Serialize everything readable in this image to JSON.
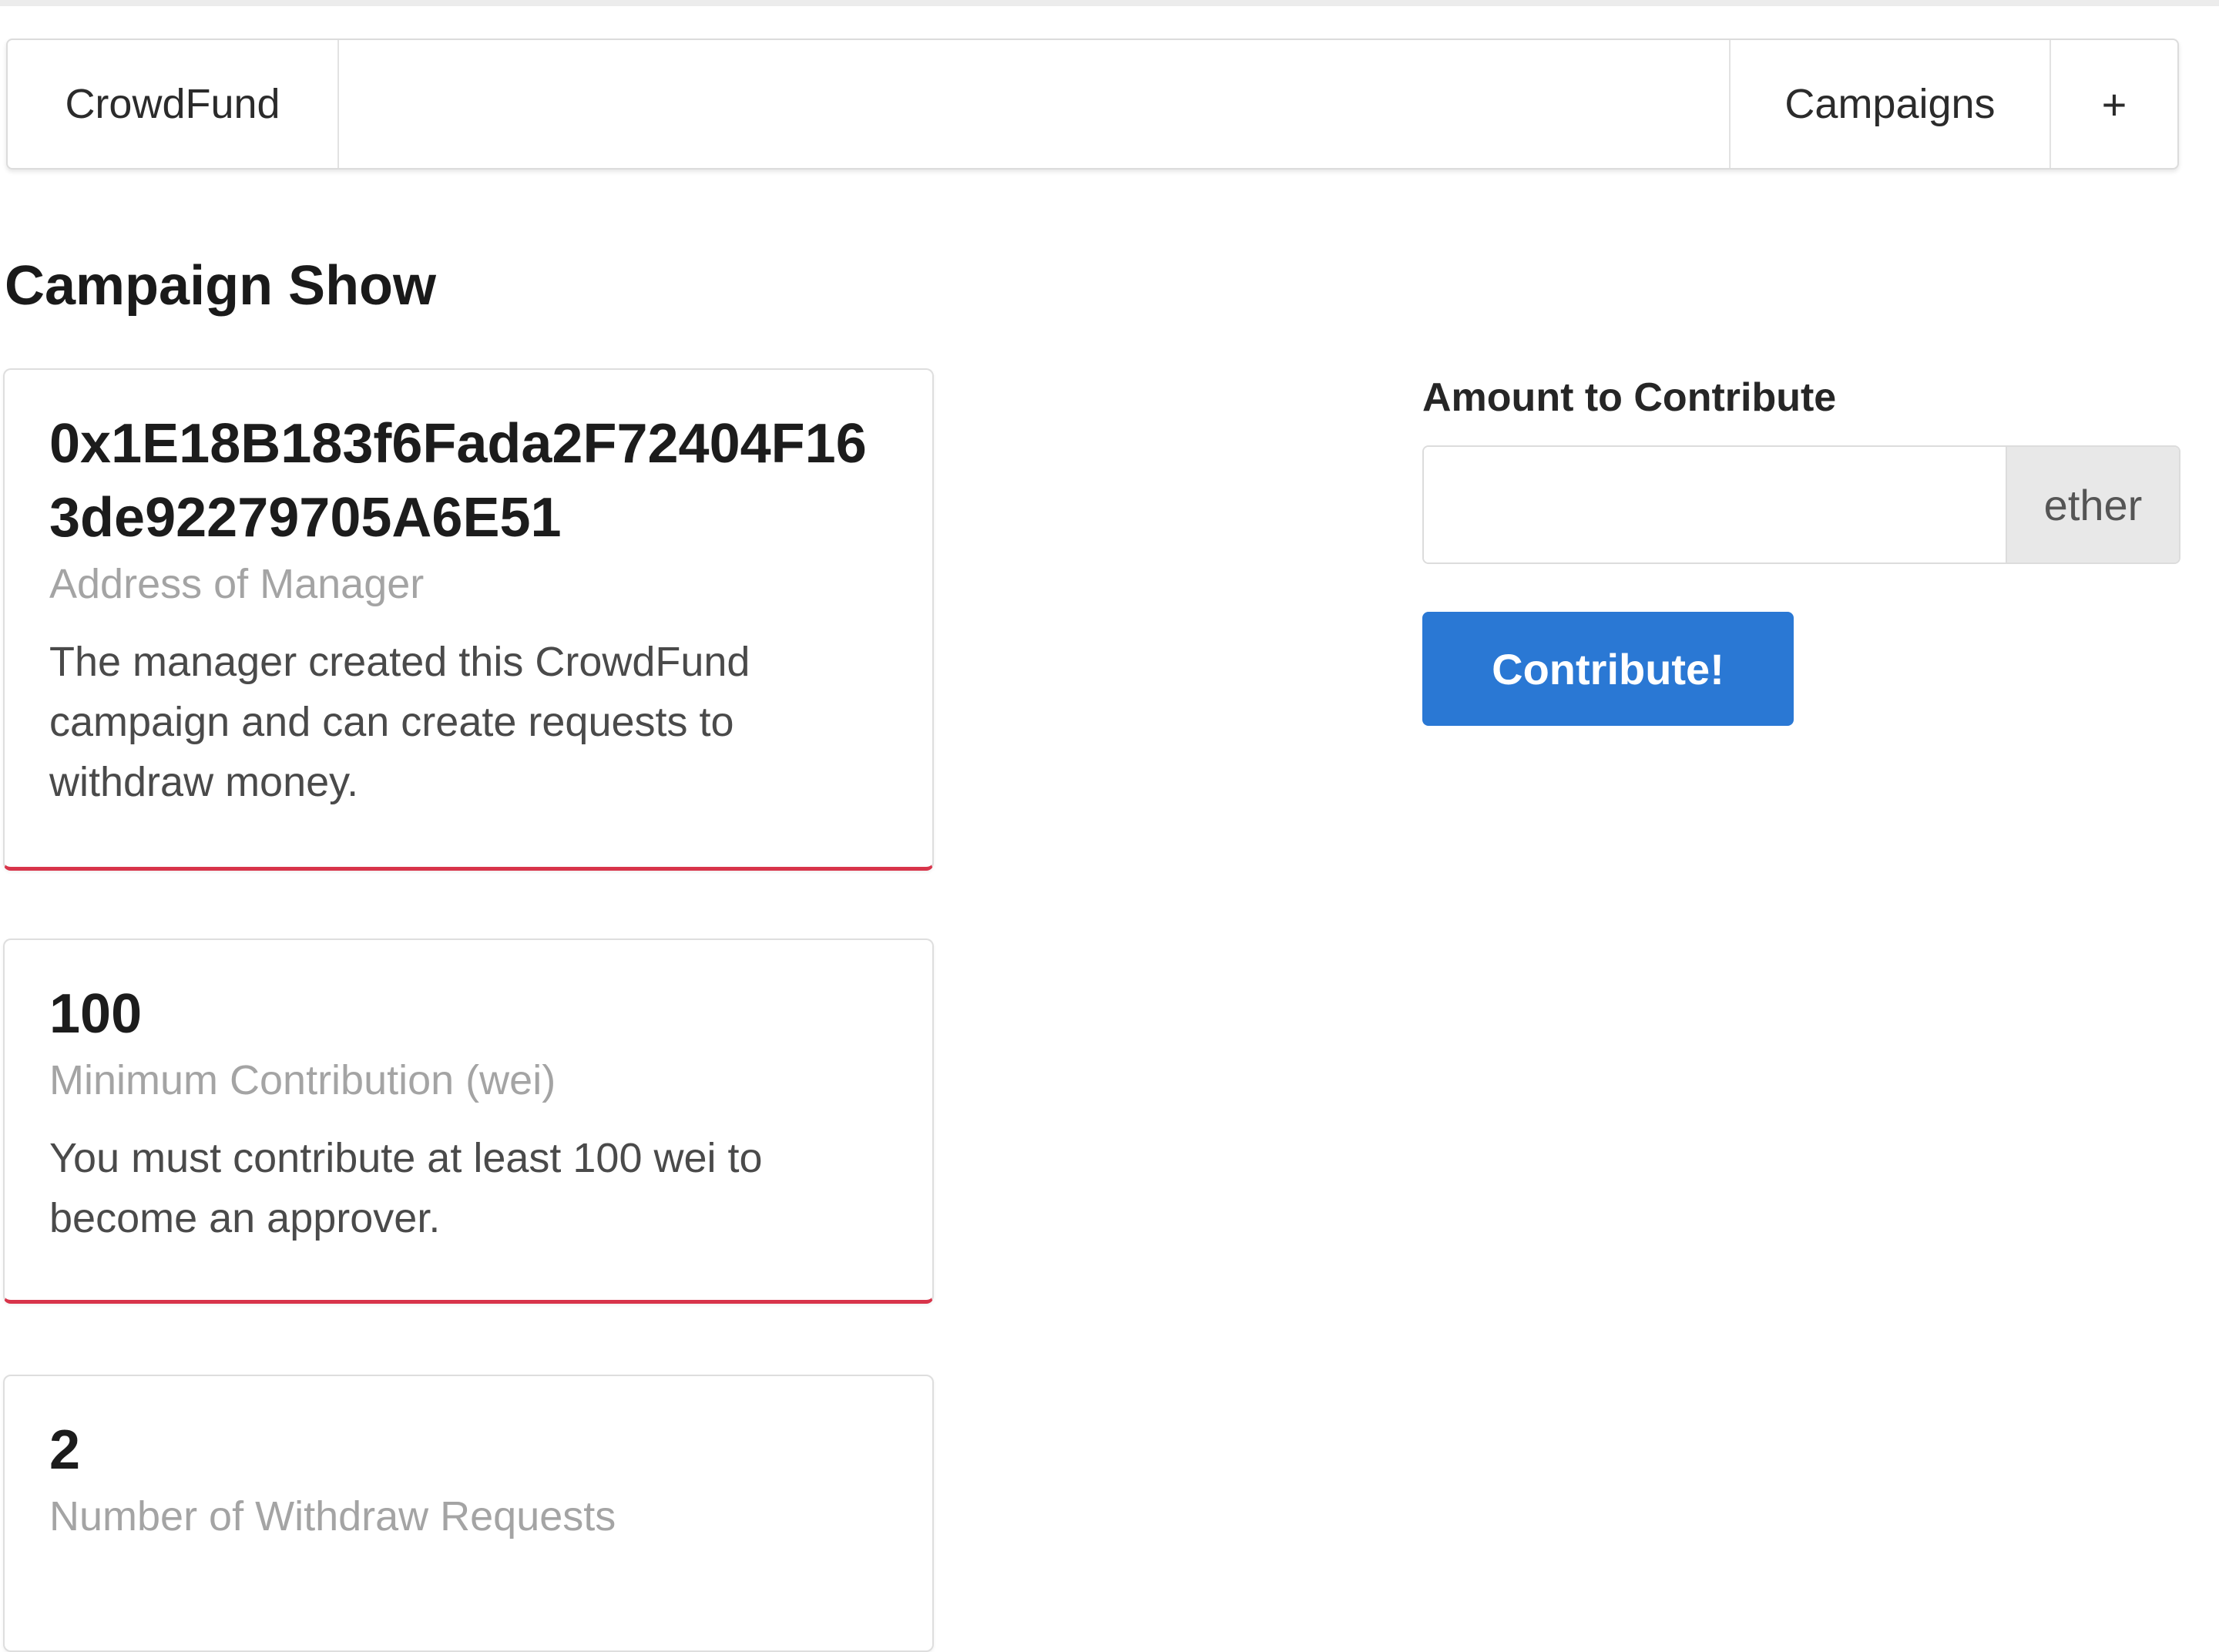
{
  "nav": {
    "brand": "CrowdFund",
    "campaigns": "Campaigns",
    "add": "+"
  },
  "page": {
    "title": "Campaign Show"
  },
  "cards": [
    {
      "header": "0x1E18B183f6Fada2F72404F163de92279705A6E51",
      "meta": "Address of Manager",
      "description": "The manager created this CrowdFund campaign and can create requests to withdraw money."
    },
    {
      "header": "100",
      "meta": "Minimum Contribution (wei)",
      "description": "You must contribute at least 100 wei to become an approver."
    },
    {
      "header": "2",
      "meta": "Number of Withdraw Requests",
      "description": ""
    }
  ],
  "form": {
    "label": "Amount to Contribute",
    "value": "",
    "unit": "ether",
    "submit": "Contribute!"
  },
  "colors": {
    "accent": "#2a78d4",
    "card_border_accent": "#d8344a"
  }
}
